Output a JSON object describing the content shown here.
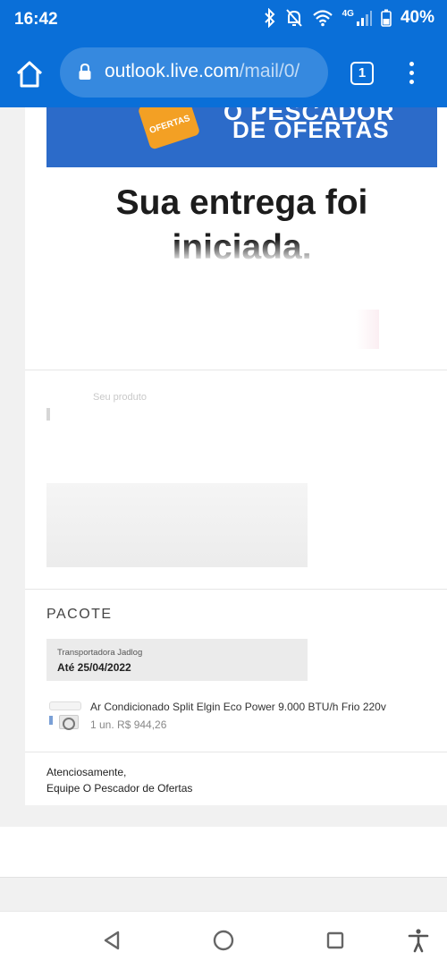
{
  "status_bar": {
    "time": "16:42",
    "network": "4G",
    "battery": "40%",
    "icons": [
      "bluetooth-icon",
      "mute-icon",
      "wifi-icon",
      "signal-icon",
      "battery-icon"
    ]
  },
  "browser": {
    "url_host": "outlook.live.com",
    "url_path": "/mail/0/",
    "tab_count": "1",
    "accent_color": "#0a6fd8"
  },
  "email": {
    "banner": {
      "badge_text": "OFERTAS",
      "line1": "O PESCADOR",
      "line2": "DE OFERTAS",
      "color": "#2c6bc9"
    },
    "headline_line1": "Sua entrega foi",
    "headline_line2": "iniciada.",
    "blurred_snippet": "Seu produto",
    "package": {
      "section_title": "PACOTE",
      "carrier": "Transportadora Jadlog",
      "eta": "Até 25/04/2022"
    },
    "product": {
      "name": "Ar Condicionado Split Elgin Eco Power 9.000 BTU/h Frio 220v",
      "qty_price": "1 un. R$ 944,26"
    },
    "signoff_line1": "Atenciosamente,",
    "signoff_line2": "Equipe O Pescador de Ofertas"
  },
  "navbar": {
    "buttons": [
      "back-icon",
      "home-circle-icon",
      "recents-icon",
      "accessibility-icon"
    ]
  }
}
